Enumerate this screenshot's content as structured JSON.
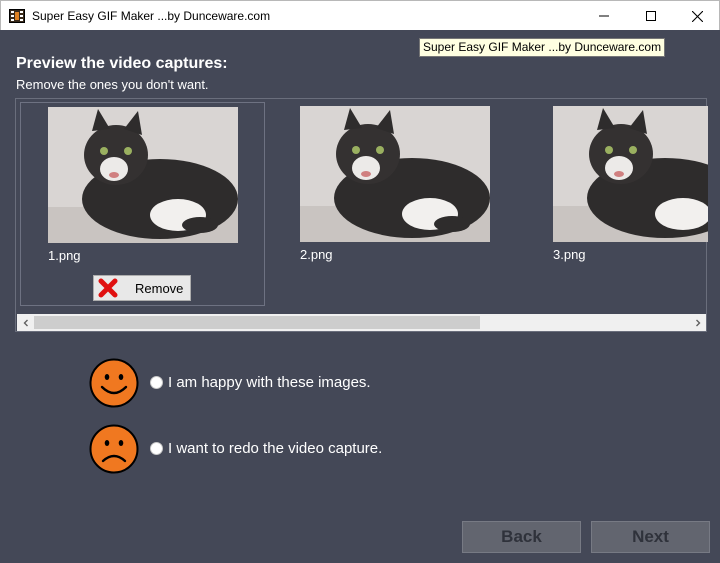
{
  "window": {
    "title": "Super Easy GIF Maker ...by Dunceware.com",
    "icons": [
      "app-icon",
      "minimize-icon",
      "maximize-icon",
      "close-icon"
    ]
  },
  "tooltip": {
    "text": "Super Easy GIF Maker ...by Dunceware.com"
  },
  "header": {
    "title": "Preview the video captures:",
    "subtitle": "Remove the ones you don't want."
  },
  "captures": {
    "items": [
      {
        "label": "1.png",
        "selected": true
      },
      {
        "label": "2.png",
        "selected": false
      },
      {
        "label": "3.png",
        "selected": false
      }
    ],
    "remove_button": {
      "label": "Remove",
      "icon": "red-x-icon"
    },
    "scrollbar": {
      "position": "start"
    }
  },
  "options": {
    "happy": {
      "label": "I am happy with these images.",
      "icon": "happy-face-icon",
      "checked": false
    },
    "redo": {
      "label": "I want to redo the video capture.",
      "icon": "sad-face-icon",
      "checked": false
    }
  },
  "nav": {
    "back_label": "Back",
    "next_label": "Next"
  },
  "colors": {
    "background": "#444857",
    "face": "#f07820",
    "remove_x": "#e01010",
    "tooltip_bg": "#ffffe1",
    "disabled_button": "#62656f"
  }
}
